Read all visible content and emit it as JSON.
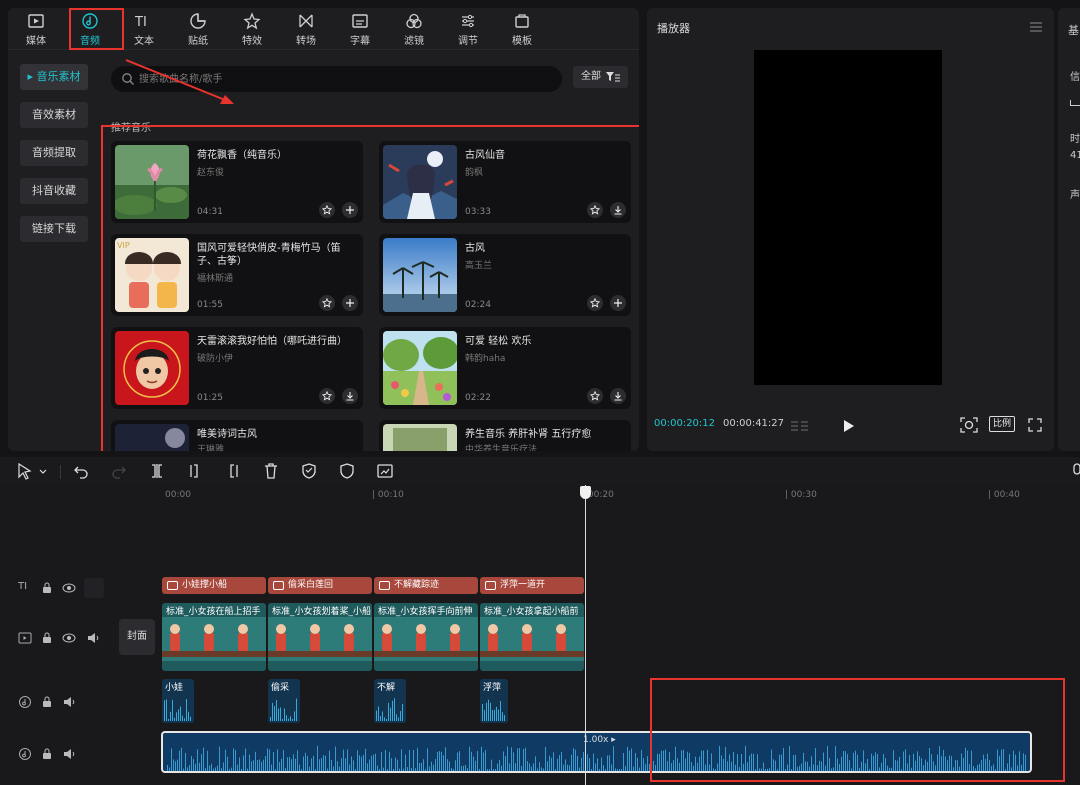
{
  "tabs": [
    {
      "label": "媒体",
      "icon": "media-icon"
    },
    {
      "label": "音频",
      "icon": "audio-icon",
      "active": true
    },
    {
      "label": "文本",
      "icon": "text-icon"
    },
    {
      "label": "贴纸",
      "icon": "sticker-icon"
    },
    {
      "label": "特效",
      "icon": "effects-icon"
    },
    {
      "label": "转场",
      "icon": "transition-icon"
    },
    {
      "label": "字幕",
      "icon": "subtitle-icon"
    },
    {
      "label": "滤镜",
      "icon": "filter-icon"
    },
    {
      "label": "调节",
      "icon": "adjust-icon"
    },
    {
      "label": "模板",
      "icon": "template-icon"
    }
  ],
  "subnav": [
    {
      "label": "音乐素材",
      "active": true
    },
    {
      "label": "音效素材"
    },
    {
      "label": "音频提取"
    },
    {
      "label": "抖音收藏"
    },
    {
      "label": "链接下载"
    }
  ],
  "search": {
    "placeholder": "搜索歌曲名称/歌手"
  },
  "filter": {
    "label": "全部"
  },
  "section_title": "推荐音乐",
  "music": [
    {
      "title": "荷花飘香（纯音乐）",
      "artist": "赵东俊",
      "duration": "04:31",
      "action": "add"
    },
    {
      "title": "古风仙音",
      "artist": "韵枫",
      "duration": "03:33",
      "action": "download"
    },
    {
      "title": "国风可爱轻快俏皮-青梅竹马（笛子、古筝）",
      "artist": "福林斯通",
      "duration": "01:55",
      "action": "add"
    },
    {
      "title": "古风",
      "artist": "高玉兰",
      "duration": "02:24",
      "action": "add"
    },
    {
      "title": "天雷滚滚我好怕怕（哪吒进行曲）",
      "artist": "破防小伊",
      "duration": "01:25",
      "action": "download"
    },
    {
      "title": "可爱 轻松 欢乐",
      "artist": "韩韵haha",
      "duration": "02:22",
      "action": "download"
    },
    {
      "title": "唯美诗词古风",
      "artist": "王琳雅",
      "duration": "",
      "action": "add"
    },
    {
      "title": "养生音乐 养肝补肾 五行疗愈",
      "artist": "中华养生音乐疗法",
      "duration": "",
      "action": "add"
    }
  ],
  "player": {
    "title": "播放器",
    "current_time": "00:00:20:12",
    "total_time": "00:00:41:27",
    "ratio_label": "比例"
  },
  "right_panel": {
    "title": "基",
    "lines": [
      "信",
      "时",
      "41",
      "声"
    ]
  },
  "timeline": {
    "ticks": [
      "00:00",
      "00:10",
      "00:20",
      "00:30",
      "00:40"
    ],
    "cover_label": "封面",
    "text_clips": [
      "小娃撑小船",
      "偷采白莲回",
      "不解藏踪迹",
      "浮萍一道开"
    ],
    "video_clips": [
      "标准_小女孩在船上招手",
      "标准_小女孩划着桨_小船",
      "标准_小女孩挥手向前伸",
      "标准_小女孩拿起小船前"
    ],
    "audio_clips": [
      "小娃",
      "偷采",
      "不解",
      "浮萍"
    ],
    "music_speed": "1.00x"
  },
  "colors": {
    "accent": "#20c4cf",
    "highlight": "#e8342c"
  }
}
